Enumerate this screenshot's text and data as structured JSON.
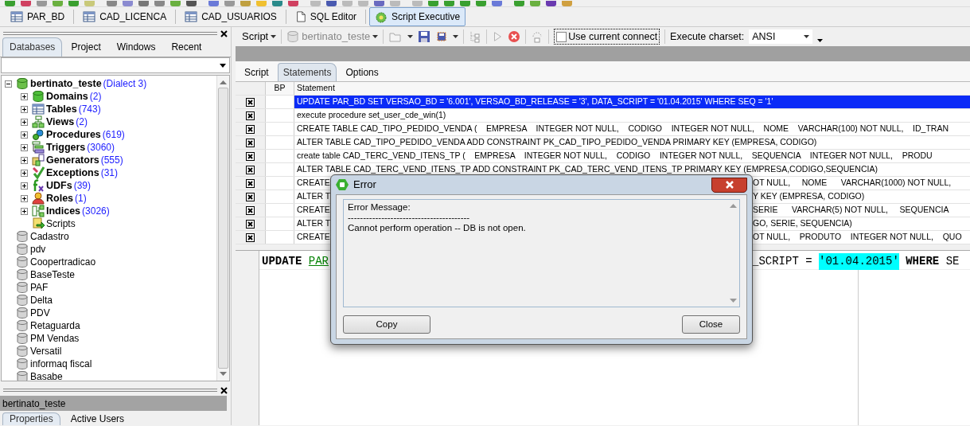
{
  "document_tabs": [
    {
      "label": "PAR_BD",
      "kind": "table",
      "selected": false
    },
    {
      "label": "CAD_LICENCA",
      "kind": "table",
      "selected": false
    },
    {
      "label": "CAD_USUARIOS",
      "kind": "table",
      "selected": false
    },
    {
      "label": "SQL Editor",
      "kind": "sql",
      "selected": false
    },
    {
      "label": "Script Executive",
      "kind": "script",
      "selected": true
    }
  ],
  "left_panel": {
    "tabs": [
      {
        "label": "Databases",
        "selected": true
      },
      {
        "label": "Project",
        "selected": false
      },
      {
        "label": "Windows",
        "selected": false
      },
      {
        "label": "Recent",
        "selected": false
      }
    ],
    "tree": [
      {
        "label": "bertinato_teste",
        "note": "(Dialect 3)",
        "kind": "database",
        "connected": true,
        "expanded": true,
        "children": [
          {
            "label": "Domains",
            "count": "(2)",
            "kind": "domains",
            "expanded": false
          },
          {
            "label": "Tables",
            "count": "(743)",
            "kind": "tables",
            "expanded": false
          },
          {
            "label": "Views",
            "count": "(2)",
            "kind": "views",
            "expanded": false
          },
          {
            "label": "Procedures",
            "count": "(619)",
            "kind": "procedures",
            "expanded": false
          },
          {
            "label": "Triggers",
            "count": "(3060)",
            "kind": "triggers",
            "expanded": false
          },
          {
            "label": "Generators",
            "count": "(555)",
            "kind": "generators",
            "expanded": false
          },
          {
            "label": "Exceptions",
            "count": "(31)",
            "kind": "exceptions",
            "expanded": false
          },
          {
            "label": "UDFs",
            "count": "(39)",
            "kind": "udfs",
            "expanded": false
          },
          {
            "label": "Roles",
            "count": "(1)",
            "kind": "roles",
            "expanded": false
          },
          {
            "label": "Indices",
            "count": "(3026)",
            "kind": "indices",
            "expanded": false
          },
          {
            "label": "Scripts",
            "kind": "scripts"
          }
        ]
      },
      {
        "label": "Cadastro",
        "kind": "database",
        "connected": false
      },
      {
        "label": "pdv",
        "kind": "database",
        "connected": false
      },
      {
        "label": "Coopertradicao",
        "kind": "database",
        "connected": false
      },
      {
        "label": "BaseTeste",
        "kind": "database",
        "connected": false
      },
      {
        "label": "PAF",
        "kind": "database",
        "connected": false
      },
      {
        "label": "Delta",
        "kind": "database",
        "connected": false
      },
      {
        "label": "PDV",
        "kind": "database",
        "connected": false
      },
      {
        "label": "Retaguarda",
        "kind": "database",
        "connected": false
      },
      {
        "label": "PM Vendas",
        "kind": "database",
        "connected": false
      },
      {
        "label": "Versatil",
        "kind": "database",
        "connected": false
      },
      {
        "label": "informaq fiscal",
        "kind": "database",
        "connected": false
      },
      {
        "label": "Basabe",
        "kind": "database",
        "connected": false
      }
    ],
    "status_title": "bertinato_teste",
    "bottom_tabs": [
      {
        "label": "Properties",
        "selected": true
      },
      {
        "label": "Active Users",
        "selected": false
      }
    ]
  },
  "toolbar": {
    "script_menu": "Script",
    "database_select": {
      "value": "bertinato_teste",
      "disabled": true
    },
    "use_current_connect": {
      "label": "Use current connect",
      "checked": false
    },
    "charset": {
      "label": "Execute charset:",
      "value": "ANSI"
    }
  },
  "script_tabs": [
    {
      "label": "Script",
      "selected": false
    },
    {
      "label": "Statements",
      "selected": true
    },
    {
      "label": "Options",
      "selected": false
    }
  ],
  "table": {
    "columns": [
      "BP",
      "Statement"
    ],
    "rows": [
      {
        "checked": true,
        "selected": true,
        "statement": "UPDATE PAR_BD SET VERSAO_BD = '6.001', VERSAO_BD_RELEASE = '3', DATA_SCRIPT = '01.04.2015' WHERE SEQ = '1'"
      },
      {
        "checked": true,
        "selected": false,
        "statement": "execute procedure set_user_cde_win(1)"
      },
      {
        "checked": true,
        "selected": false,
        "statement": "CREATE TABLE CAD_TIPO_PEDIDO_VENDA (    EMPRESA    INTEGER NOT NULL,    CODIGO    INTEGER NOT NULL,    NOME    VARCHAR(100) NOT NULL,    ID_TRAN"
      },
      {
        "checked": true,
        "selected": false,
        "statement": "ALTER TABLE CAD_TIPO_PEDIDO_VENDA ADD CONSTRAINT PK_CAD_TIPO_PEDIDO_VENDA PRIMARY KEY (EMPRESA, CODIGO)"
      },
      {
        "checked": true,
        "selected": false,
        "statement": "create table CAD_TERC_VEND_ITENS_TP (    EMPRESA    INTEGER NOT NULL,    CODIGO    INTEGER NOT NULL,    SEQUENCIA    INTEGER NOT NULL,    PRODU"
      },
      {
        "checked": true,
        "selected": false,
        "statement": "ALTER TABLE CAD_TERC_VEND_ITENS_TP ADD CONSTRAINT PK_CAD_TERC_VEND_ITENS_TP PRIMARY KEY (EMPRESA,CODIGO,SEQUENCIA)"
      },
      {
        "checked": true,
        "selected": false,
        "statement_start": "CREATE",
        "statement_end": "OT NULL,     NOME      VARCHAR(1000) NOT NULL,"
      },
      {
        "checked": true,
        "selected": false,
        "statement_start": "ALTER T",
        "statement_end": "Y KEY (EMPRESA, CODIGO)"
      },
      {
        "checked": true,
        "selected": false,
        "statement_start": "CREATE",
        "statement_end": "SERIE      VARCHAR(5) NOT NULL,     SEQUENCIA"
      },
      {
        "checked": true,
        "selected": false,
        "statement_start": "ALTER T",
        "statement_end": "GO, SERIE, SEQUENCIA)"
      },
      {
        "checked": true,
        "selected": false,
        "statement_start": "CREATE",
        "statement_end": "OT NULL,    PRODUTO    INTEGER NOT NULL,    QUO"
      }
    ]
  },
  "editor": {
    "line_start": [
      {
        "text": "UPDATE",
        "kind": "keyword"
      },
      {
        "text": "PAR",
        "kind": "table"
      }
    ],
    "line_end": [
      {
        "text": "_SCRIPT",
        "kind": "plain"
      },
      {
        "text": "=",
        "kind": "plain"
      },
      {
        "text": "'01.04.2015'",
        "kind": "string"
      },
      {
        "text": "WHERE",
        "kind": "keyword"
      },
      {
        "text": "SE",
        "kind": "plain"
      }
    ]
  },
  "dialog": {
    "title": "Error",
    "message": [
      "Error Message:",
      "----------------------------------------",
      "Cannot perform operation -- DB is not open."
    ],
    "buttons": [
      "Copy",
      "Close"
    ]
  }
}
